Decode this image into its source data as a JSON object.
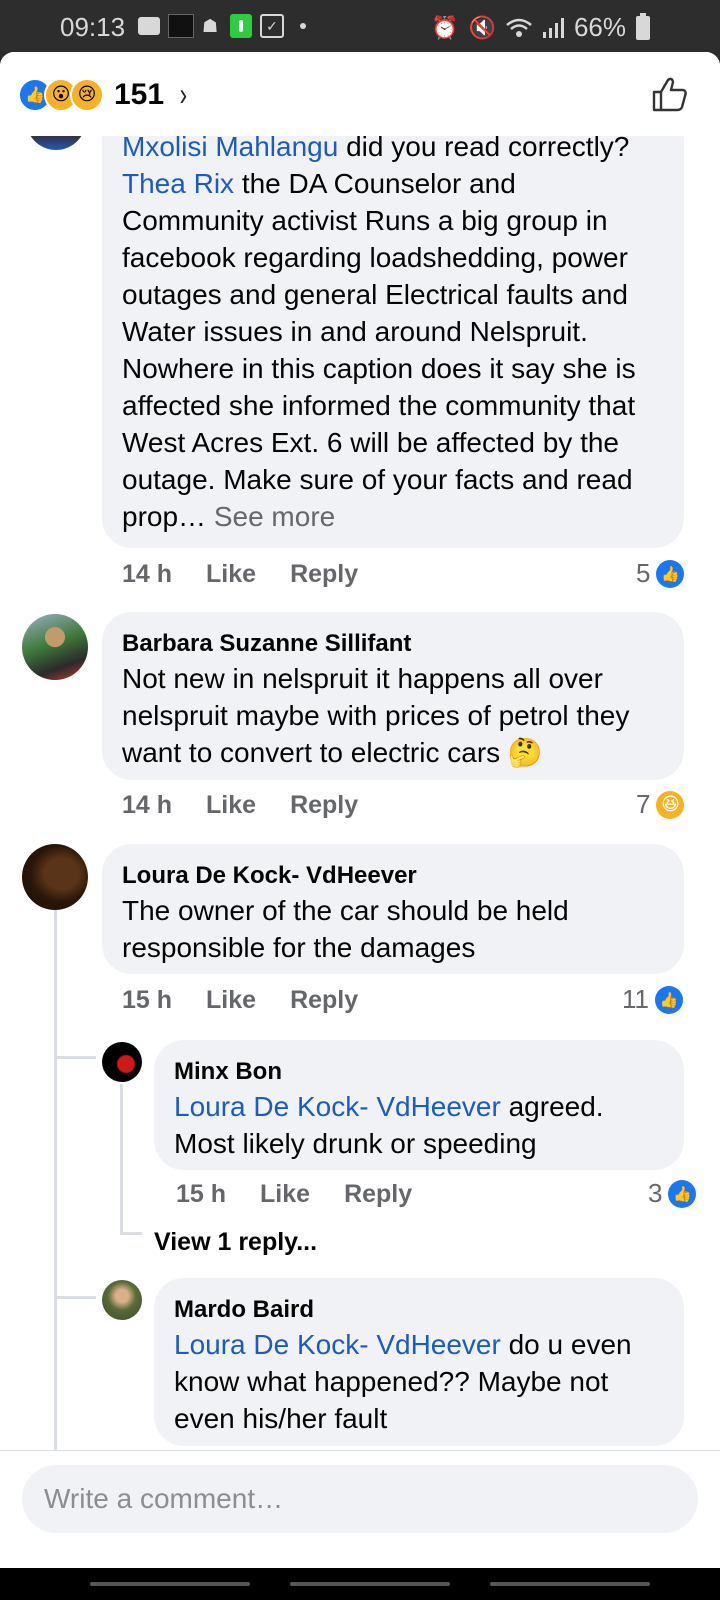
{
  "status_bar": {
    "time": "09:13",
    "battery": "66%",
    "icons": [
      "message-icon",
      "app-icon",
      "bug-icon",
      "download-icon",
      "check-icon",
      "dot-icon",
      "alarm-icon",
      "mute-icon",
      "wifi-icon",
      "signal-icon",
      "battery-icon"
    ]
  },
  "header": {
    "reaction_icons": [
      "like-icon",
      "wow-icon",
      "sad-icon"
    ],
    "reaction_count": "151",
    "chevron": "›"
  },
  "comments": [
    {
      "mention1": "Mxolisi Mahlangu",
      "text1": " did you read correctly? ",
      "mention2": "Thea Rix",
      "text2": " the DA Counselor and Community activist Runs a big group in facebook regarding loadshedding, power outages and general Electrical faults and Water issues in and around Nelspruit. Nowhere in this caption does it say she is affected she informed the community that West Acres Ext. 6 will be affected by the outage. Make sure of your facts and read prop… ",
      "see_more": "See more",
      "time": "14 h",
      "like": "Like",
      "reply": "Reply",
      "reaction_count": "5"
    },
    {
      "author": "Barbara Suzanne Sillifant",
      "text": "Not new in nelspruit it happens all over nelspruit maybe with prices of petrol they want to convert to electric cars 🤔",
      "time": "14 h",
      "like": "Like",
      "reply": "Reply",
      "reaction_count": "7"
    },
    {
      "author": "Loura De Kock- VdHeever",
      "text": "The owner of the car should be held responsible for the damages",
      "time": "15 h",
      "like": "Like",
      "reply": "Reply",
      "reaction_count": "11"
    },
    {
      "author": "Minx Bon",
      "mention": "Loura De Kock- VdHeever",
      "text": " agreed. Most likely drunk or speeding",
      "time": "15 h",
      "like": "Like",
      "reply": "Reply",
      "reaction_count": "3",
      "view_replies": "View 1 reply..."
    },
    {
      "author": "Mardo Baird",
      "mention": "Loura De Kock- VdHeever",
      "text": " do u even know what happened?? Maybe not even his/her fault"
    }
  ],
  "composer": {
    "placeholder": "Write a comment…"
  }
}
